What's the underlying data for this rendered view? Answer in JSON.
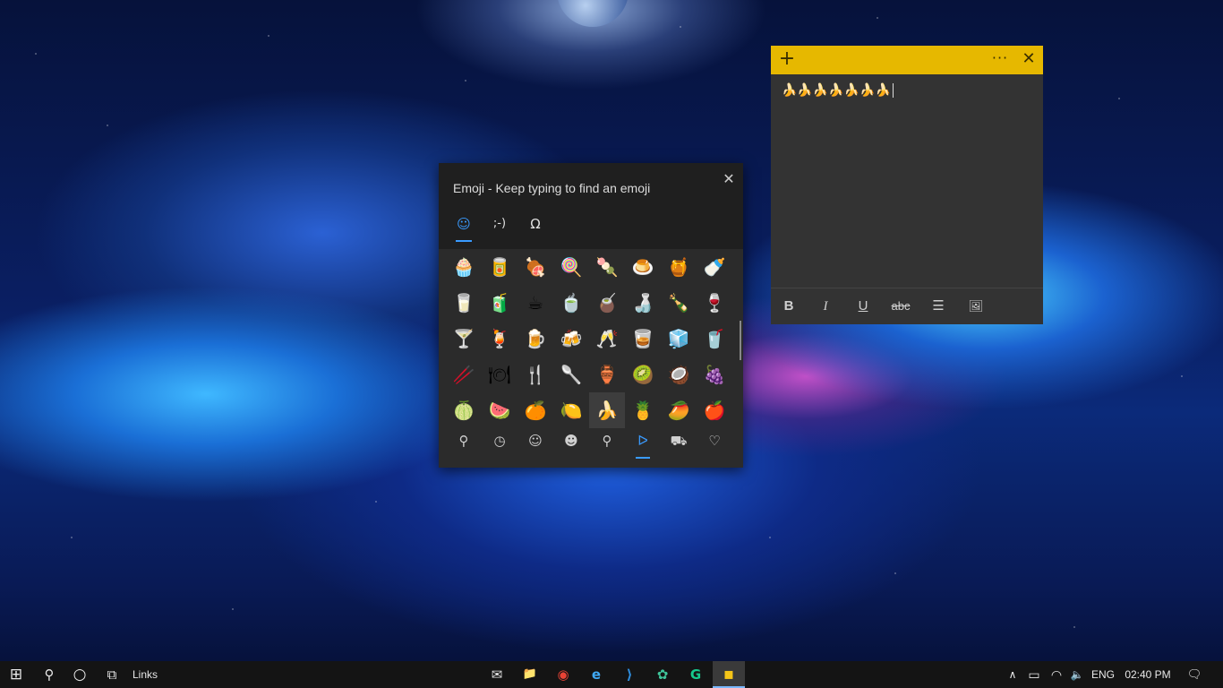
{
  "sticky_note": {
    "add_icon": "+",
    "more_icon": "···",
    "close_icon": "✕",
    "text": "🍌🍌🍌🍌🍌🍌🍌",
    "toolbar": {
      "bold": "B",
      "italic": "I",
      "underline": "U",
      "strikethrough": "abc",
      "list_icon": "☰",
      "image_icon": "🖼"
    }
  },
  "emoji_panel": {
    "title": "Emoji - Keep typing to find an emoji",
    "close_icon": "✕",
    "tabs": [
      {
        "name": "emoji",
        "glyph": "☺"
      },
      {
        "name": "kaomoji",
        "glyph": ";-)"
      },
      {
        "name": "symbols",
        "glyph": "Ω"
      }
    ],
    "grid": [
      [
        "🧁",
        "🥫",
        "🍖",
        "🍭",
        "🍡",
        "🍮",
        "🍯",
        "🍼"
      ],
      [
        "🥛",
        "🧃",
        "☕",
        "🍵",
        "🧉",
        "🍶",
        "🍾",
        "🍷"
      ],
      [
        "🍸",
        "🍹",
        "🍺",
        "🍻",
        "🥂",
        "🥃",
        "🧊",
        "🥤"
      ],
      [
        "🥢",
        "🍽",
        "🍴",
        "🥄",
        "🏺",
        "🥝",
        "🥥",
        "🍇"
      ],
      [
        "🍈",
        "🍉",
        "🍊",
        "🍋",
        "🍌",
        "🍍",
        "🥭",
        "🍎"
      ]
    ],
    "selected_emoji": "🍌",
    "categories": [
      {
        "name": "search",
        "glyph": "⚲"
      },
      {
        "name": "recent",
        "glyph": "◷"
      },
      {
        "name": "smileys",
        "glyph": "☺"
      },
      {
        "name": "people",
        "glyph": "☻"
      },
      {
        "name": "celebration",
        "glyph": "⚲"
      },
      {
        "name": "food",
        "glyph": "ᐅ"
      },
      {
        "name": "travel",
        "glyph": "⛟"
      },
      {
        "name": "symbols",
        "glyph": "♡"
      }
    ]
  },
  "taskbar": {
    "start_icon": "⊞",
    "search_icon": "⚲",
    "cortana_icon": "○",
    "taskview_icon": "⧉",
    "links_label": "Links",
    "apps": [
      {
        "name": "mail",
        "glyph": "✉"
      },
      {
        "name": "file-explorer",
        "glyph": "📁"
      },
      {
        "name": "chrome",
        "glyph": "◉"
      },
      {
        "name": "edge",
        "glyph": "e"
      },
      {
        "name": "vscode",
        "glyph": "⟩"
      },
      {
        "name": "app-green",
        "glyph": "✿"
      },
      {
        "name": "grammarly",
        "glyph": "G"
      },
      {
        "name": "sticky-notes",
        "glyph": "▪"
      }
    ],
    "tray": {
      "chevron": "∧",
      "battery": "▭",
      "wifi": "◠",
      "volume": "🔈",
      "language": "ENG",
      "time": "02:40 PM",
      "notifications": "🗨"
    }
  }
}
